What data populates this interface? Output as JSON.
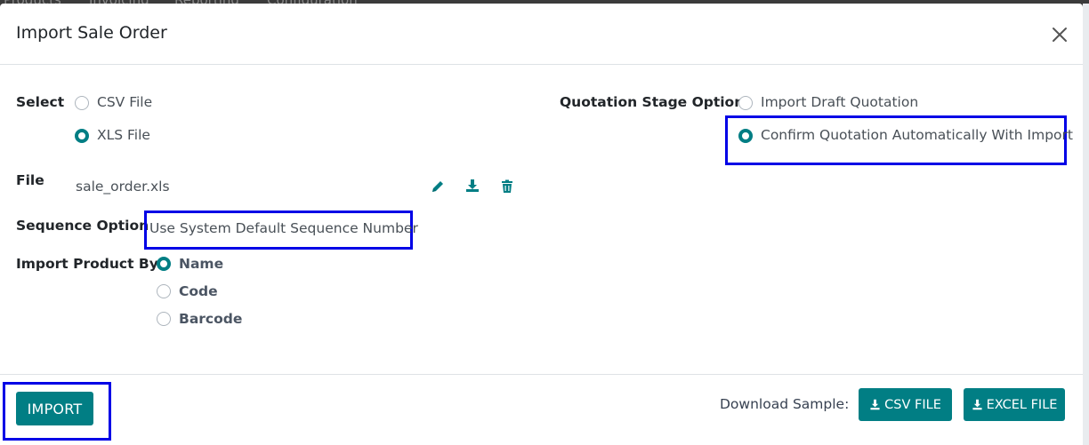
{
  "background_nav": {
    "items": [
      "Products",
      "Invoicing",
      "Reporting",
      "Configuration"
    ]
  },
  "dialog": {
    "title": "Import Sale Order",
    "close_label": "×"
  },
  "form": {
    "select_label": "Select",
    "file_types": [
      {
        "label": "CSV File",
        "checked": false
      },
      {
        "label": "XLS File",
        "checked": true
      }
    ],
    "file_label": "File",
    "file_name": "sale_order.xls",
    "sequence_label": "Sequence Option",
    "sequence_value": "Use System Default Sequence Number",
    "import_product_by_label": "Import Product By",
    "product_options": [
      {
        "label": "Name",
        "checked": true
      },
      {
        "label": "Code",
        "checked": false
      },
      {
        "label": "Barcode",
        "checked": false
      }
    ],
    "quotation_stage_label": "Quotation Stage Option",
    "quotation_options": [
      {
        "label": "Import Draft Quotation",
        "checked": false
      },
      {
        "label": "Confirm Quotation Automatically With Import",
        "checked": true
      }
    ]
  },
  "footer": {
    "import_button": "IMPORT",
    "download_sample_label": "Download Sample:",
    "csv_button": "CSV FILE",
    "excel_button": "EXCEL FILE"
  },
  "colors": {
    "primary": "#017e84",
    "highlight": "#0000e6"
  },
  "icons": [
    "close-icon",
    "pencil-icon",
    "download-icon",
    "trash-icon"
  ]
}
